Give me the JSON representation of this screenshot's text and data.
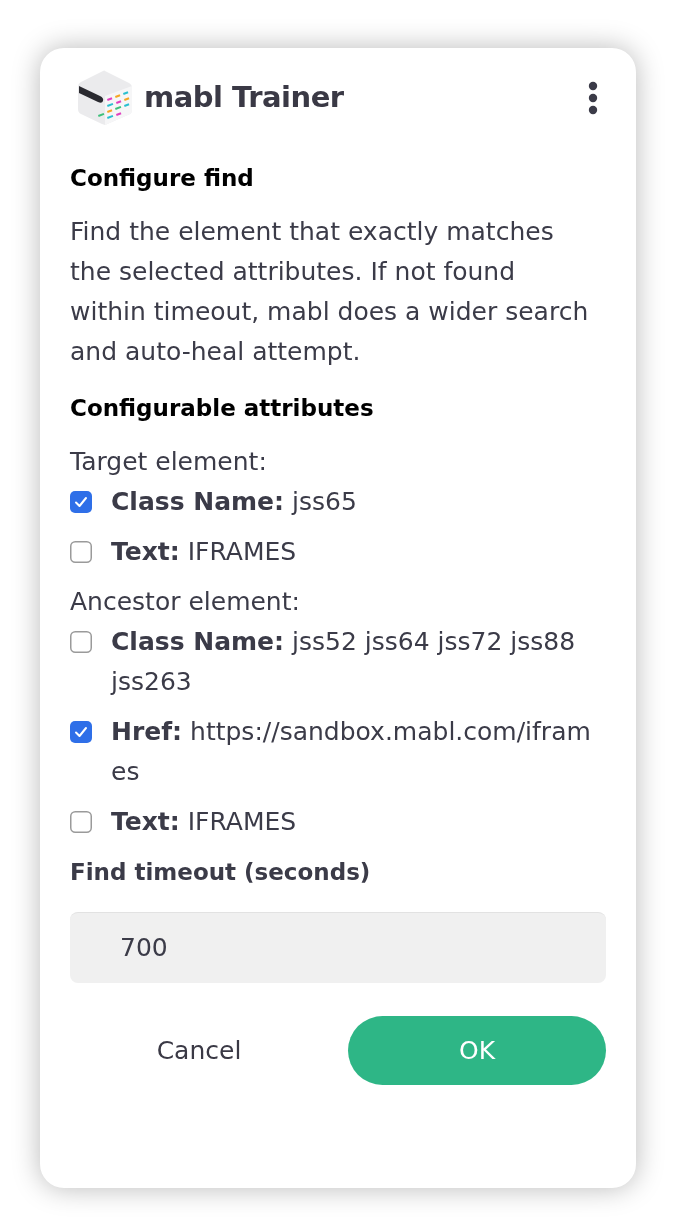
{
  "header": {
    "title": "mabl Trainer"
  },
  "configure": {
    "title": "Configure find",
    "description": "Find the element that exactly matches the selected attributes. If not found within timeout, mabl does a wider search and auto-heal attempt."
  },
  "attributes": {
    "title": "Configurable attributes",
    "groups": [
      {
        "label": "Target element:",
        "items": [
          {
            "name": "Class Name:",
            "value": "jss65",
            "checked": true
          },
          {
            "name": "Text:",
            "value": "IFRAMES",
            "checked": false
          }
        ]
      },
      {
        "label": "Ancestor element:",
        "items": [
          {
            "name": "Class Name:",
            "value": "jss52 jss64 jss72 jss88 jss263",
            "checked": false
          },
          {
            "name": "Href:",
            "value": "https://sandbox.mabl.com/iframes",
            "checked": true
          },
          {
            "name": "Text:",
            "value": "IFRAMES",
            "checked": false
          }
        ]
      }
    ]
  },
  "timeout": {
    "label": "Find timeout (seconds)",
    "value": "700"
  },
  "buttons": {
    "cancel": "Cancel",
    "ok": "OK"
  }
}
